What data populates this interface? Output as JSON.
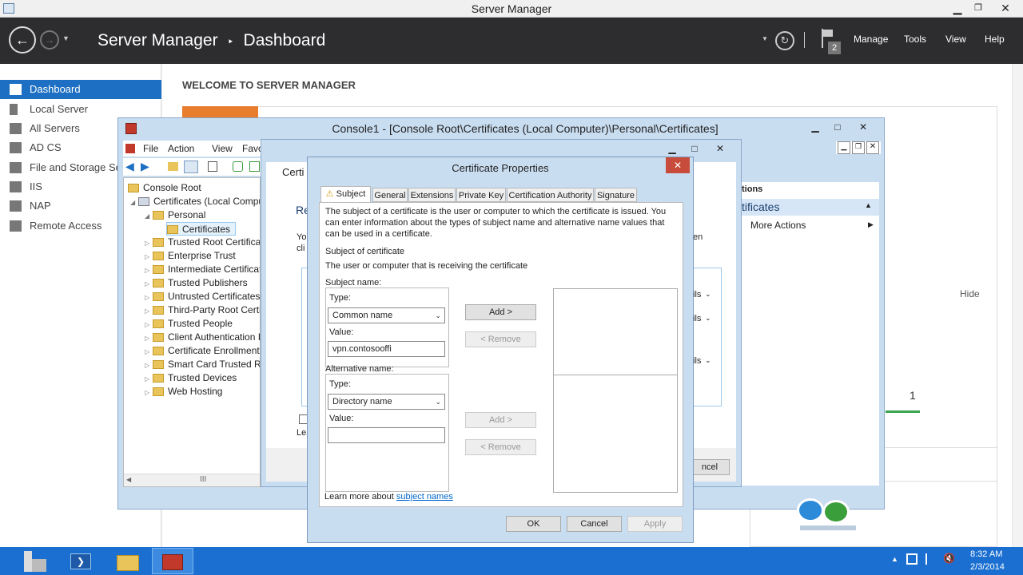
{
  "server_manager": {
    "title": "Server Manager",
    "breadcrumb_app": "Server Manager",
    "breadcrumb_sep": "‣",
    "breadcrumb_page": "Dashboard",
    "menu": [
      "Manage",
      "Tools",
      "View",
      "Help"
    ],
    "flag_badge": "2",
    "nav": [
      {
        "label": "Dashboard",
        "icon": "dashboard-icon",
        "selected": true
      },
      {
        "label": "Local Server",
        "icon": "server-icon"
      },
      {
        "label": "All Servers",
        "icon": "servers-icon"
      },
      {
        "label": "AD CS",
        "icon": "adcs-icon"
      },
      {
        "label": "File and Storage Se",
        "icon": "storage-icon"
      },
      {
        "label": "IIS",
        "icon": "iis-icon"
      },
      {
        "label": "NAP",
        "icon": "nap-icon"
      },
      {
        "label": "Remote Access",
        "icon": "remote-icon"
      }
    ],
    "welcome": "WELCOME TO SERVER MANAGER",
    "hide_link": "Hide",
    "tile_count": "1"
  },
  "console": {
    "title": "Console1 - [Console Root\\Certificates (Local Computer)\\Personal\\Certificates]",
    "menu": [
      "File",
      "Action",
      "View",
      "Favori"
    ],
    "tree": [
      {
        "label": "Console Root",
        "level": 0,
        "expander": ""
      },
      {
        "label": "Certificates (Local Comput",
        "level": 1,
        "expander": "◢"
      },
      {
        "label": "Personal",
        "level": 2,
        "expander": "◢"
      },
      {
        "label": "Certificates",
        "level": 3,
        "expander": "",
        "selected": true
      },
      {
        "label": "Trusted Root Certificat",
        "level": 2,
        "expander": "▷"
      },
      {
        "label": "Enterprise Trust",
        "level": 2,
        "expander": "▷"
      },
      {
        "label": "Intermediate Certificat",
        "level": 2,
        "expander": "▷"
      },
      {
        "label": "Trusted Publishers",
        "level": 2,
        "expander": "▷"
      },
      {
        "label": "Untrusted Certificates",
        "level": 2,
        "expander": "▷"
      },
      {
        "label": "Third-Party Root Certif",
        "level": 2,
        "expander": "▷"
      },
      {
        "label": "Trusted People",
        "level": 2,
        "expander": "▷"
      },
      {
        "label": "Client Authentication I",
        "level": 2,
        "expander": "▷"
      },
      {
        "label": "Certificate Enrollment",
        "level": 2,
        "expander": "▷"
      },
      {
        "label": "Smart Card Trusted Ro",
        "level": 2,
        "expander": "▷"
      },
      {
        "label": "Trusted Devices",
        "level": 2,
        "expander": "▷"
      },
      {
        "label": "Web Hosting",
        "level": 2,
        "expander": "▷"
      }
    ],
    "scroll_grip": "III",
    "actions_header": "tions",
    "actions_section": "tificates",
    "more_actions": "More Actions"
  },
  "wizard": {
    "title_partial": "Certi",
    "heading_partial": "Re",
    "text_partial_1": "Yo",
    "text_partial_2": "cli",
    "text_right": "en",
    "details_label": "ils",
    "learn_partial": "Lea",
    "cancel_partial": "ncel"
  },
  "dialog": {
    "title": "Certificate Properties",
    "tabs": [
      "Subject",
      "General",
      "Extensions",
      "Private Key",
      "Certification Authority",
      "Signature"
    ],
    "intro": [
      "The subject of a certificate is the user or computer to which the certificate is issued. You",
      "can enter information about the types of subject name and alternative name values that",
      "can be used in a certificate."
    ],
    "subject_heading": "Subject of certificate",
    "subject_desc": "The user or computer that is receiving the certificate",
    "subject_name_label": "Subject name:",
    "type_label": "Type:",
    "subject_type_value": "Common name",
    "value_label": "Value:",
    "subject_value": "vpn.contosooffi",
    "alt_name_label": "Alternative name:",
    "alt_type_value": "Directory name",
    "alt_value": "",
    "add_label": "Add >",
    "remove_label": "< Remove",
    "learn_prefix": "Learn more about",
    "learn_link": "subject names",
    "ok_label": "OK",
    "cancel_label": "Cancel",
    "apply_label": "Apply"
  },
  "taskbar": {
    "time": "8:32 AM",
    "date": "2/3/2014"
  },
  "colors": {
    "selected_nav": "#1c6fc2",
    "taskbar": "#1a6fd1",
    "header": "#2d2d30"
  }
}
